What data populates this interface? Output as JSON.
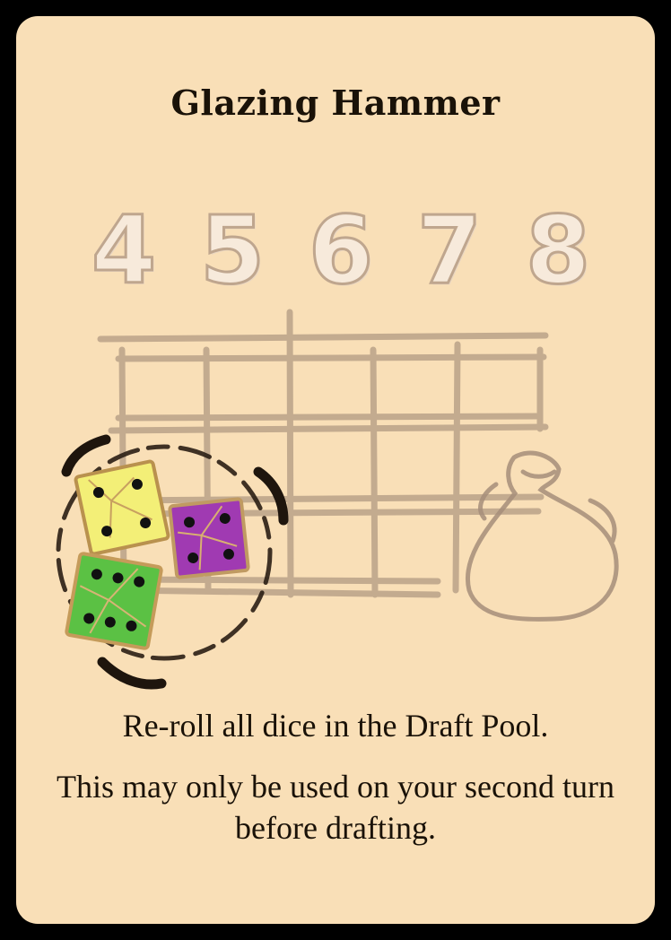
{
  "card": {
    "title": "Glazing Hammer",
    "favor_numbers": [
      "4",
      "5",
      "6",
      "7",
      "8"
    ],
    "ability_text": "Re-roll all dice in the Draft Pool.",
    "restriction_text": "This may only be used on your second turn before drafting."
  },
  "illustration": {
    "icons": [
      "window-grid-sketch",
      "dice-reroll-icon",
      "dice-bag-icon"
    ],
    "dice": [
      {
        "color": "#f4f07a",
        "pips": 4
      },
      {
        "color": "#a53bb5",
        "pips": 4
      },
      {
        "color": "#5cc146",
        "pips": 6
      }
    ]
  },
  "colors": {
    "card_background": "#f9dfb7",
    "border": "#000000",
    "text": "#1a1208"
  }
}
